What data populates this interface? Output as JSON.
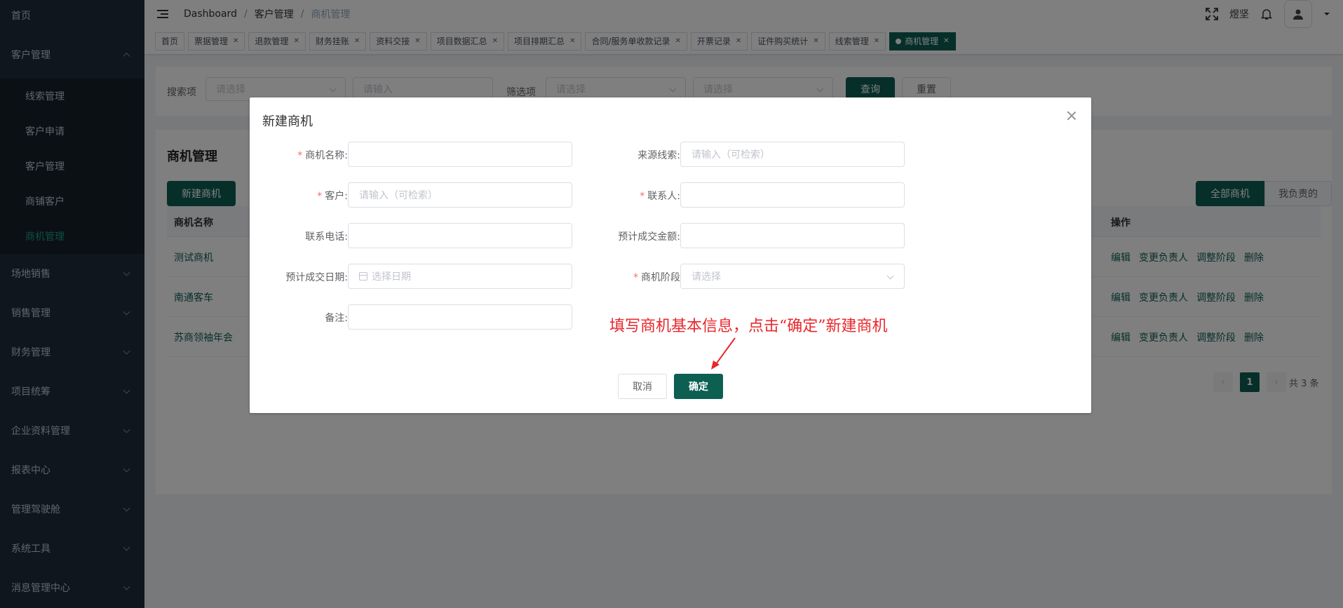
{
  "sidebar": {
    "home": "首页",
    "customer_group": "客户管理",
    "sub_items": [
      "线索管理",
      "客户申请",
      "客户管理",
      "商铺客户",
      "商机管理"
    ],
    "groups": [
      "场地销售",
      "销售管理",
      "财务管理",
      "项目统筹",
      "企业资料管理",
      "报表中心",
      "管理驾驶舱",
      "系统工具",
      "消息管理中心"
    ]
  },
  "header": {
    "breadcrumb": [
      "Dashboard",
      "客户管理",
      "商机管理"
    ],
    "username": "煜坚"
  },
  "tags": [
    "首页",
    "票据管理",
    "退款管理",
    "财务挂账",
    "资料交接",
    "项目数据汇总",
    "项目排期汇总",
    "合同/服务单收款记录",
    "开票记录",
    "证件购买统计",
    "线索管理",
    "商机管理"
  ],
  "search": {
    "label1": "搜索项",
    "select1": "请选择",
    "input1": "请输入",
    "label2": "筛选项",
    "select2": "请选择",
    "select3": "请选择",
    "query": "查询",
    "reset": "重置"
  },
  "list": {
    "title": "商机管理",
    "new_button": "新建商机",
    "toggle_all": "全部商机",
    "toggle_mine": "我负责的",
    "col_name": "商机名称",
    "col_ops": "操作",
    "rows": [
      "测试商机",
      "南通客车",
      "苏商领袖年会"
    ],
    "ops": [
      "编辑",
      "变更负责人",
      "调整阶段",
      "删除"
    ],
    "pager": {
      "current": "1",
      "total": "共 3 条"
    }
  },
  "dialog": {
    "title": "新建商机",
    "fields": {
      "name_label": "商机名称:",
      "source_label": "来源线索:",
      "source_placeholder": "请输入（可检索）",
      "customer_label": "客户:",
      "customer_placeholder": "请输入（可检索）",
      "contact_label": "联系人:",
      "phone_label": "联系电话:",
      "amount_label": "预计成交金额:",
      "date_label": "预计成交日期:",
      "date_placeholder": "选择日期",
      "stage_label": "商机阶段",
      "stage_placeholder": "请选择",
      "remark_label": "备注:"
    },
    "cancel": "取消",
    "confirm": "确定",
    "annotation": "填写商机基本信息，点击“确定”新建商机"
  },
  "colors": {
    "primary": "#0d5f52",
    "sidebar": "#1f2d3d",
    "annotation": "#e8262b"
  }
}
